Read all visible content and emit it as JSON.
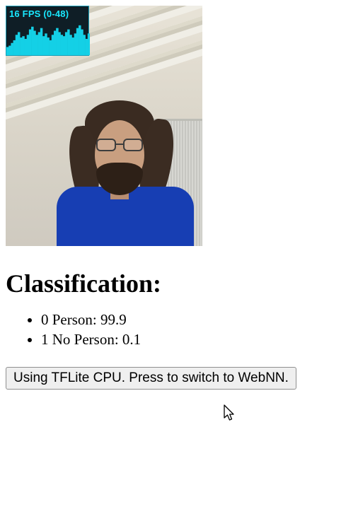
{
  "fps": {
    "label": "16 FPS (0-48)"
  },
  "heading": "Classification:",
  "results": [
    {
      "text": "0 Person: 99.9"
    },
    {
      "text": "1 No Person: 0.1"
    }
  ],
  "button": {
    "label": "Using TFLite CPU. Press to switch to WebNN."
  },
  "chart_data": {
    "type": "bar",
    "categories": [],
    "values": [
      12,
      14,
      18,
      22,
      30,
      34,
      26,
      28,
      24,
      30,
      38,
      42,
      36,
      30,
      34,
      40,
      28,
      32,
      26,
      22,
      30,
      36,
      40,
      34,
      30,
      28,
      34,
      38,
      30,
      26,
      32,
      40,
      44,
      38,
      30,
      24,
      32
    ],
    "title": "FPS history",
    "xlabel": "",
    "ylabel": "FPS",
    "ylim": [
      0,
      48
    ]
  }
}
